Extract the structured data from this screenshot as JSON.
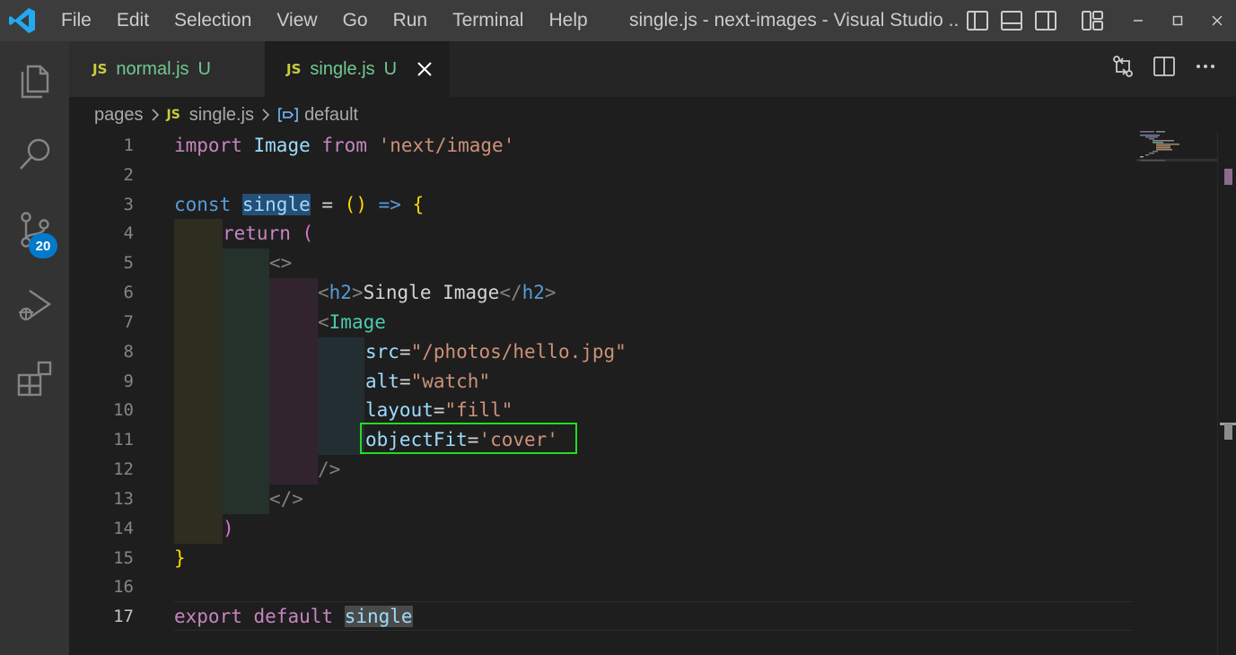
{
  "menu": [
    "File",
    "Edit",
    "Selection",
    "View",
    "Go",
    "Run",
    "Terminal",
    "Help"
  ],
  "window_title": "single.js - next-images - Visual Studio ...",
  "activity": {
    "source_control_badge": "20"
  },
  "tabs": [
    {
      "badge": "JS",
      "name": "normal.js",
      "status": "U"
    },
    {
      "badge": "JS",
      "name": "single.js",
      "status": "U"
    }
  ],
  "breadcrumb": {
    "folder": "pages",
    "file_badge": "JS",
    "file": "single.js",
    "symbol": "default"
  },
  "line_numbers": [
    "1",
    "2",
    "3",
    "4",
    "5",
    "6",
    "7",
    "8",
    "9",
    "10",
    "11",
    "12",
    "13",
    "14",
    "15",
    "16",
    "17"
  ],
  "current_line": "17",
  "code": {
    "l1": {
      "import": "import",
      "ident": "Image",
      "from": "from",
      "module": "'next/image'"
    },
    "l3": {
      "const": "const",
      "name": "single",
      "eq": " = ",
      "paren": "()",
      "arrow": "=>",
      "brace": "{"
    },
    "l4": {
      "ret": "return",
      "paren": "("
    },
    "l5": {
      "frag_open": "<>"
    },
    "l6": {
      "lt": "<",
      "tag": "h2",
      "gt": ">",
      "text": "Single Image",
      "close_lt": "</",
      "close_tag": "h2",
      "close_gt": ">"
    },
    "l7": {
      "lt": "<",
      "comp": "Image"
    },
    "l8": {
      "attr": "src",
      "eq": "=",
      "val": "\"/photos/hello.jpg\""
    },
    "l9": {
      "attr": "alt",
      "eq": "=",
      "val": "\"watch\""
    },
    "l10": {
      "attr": "layout",
      "eq": "=",
      "val": "\"fill\""
    },
    "l11": {
      "attr": "objectFit",
      "eq": "=",
      "val": "'cover'"
    },
    "l12": {
      "self_close": "/>"
    },
    "l13": {
      "frag_close": "</>"
    },
    "l14": {
      "paren": ")"
    },
    "l15": {
      "brace": "}"
    },
    "l17": {
      "export": "export",
      "default": "default",
      "name": "single"
    }
  },
  "colors": {
    "accent": "#007acc",
    "highlight_box": "#22dd22"
  }
}
